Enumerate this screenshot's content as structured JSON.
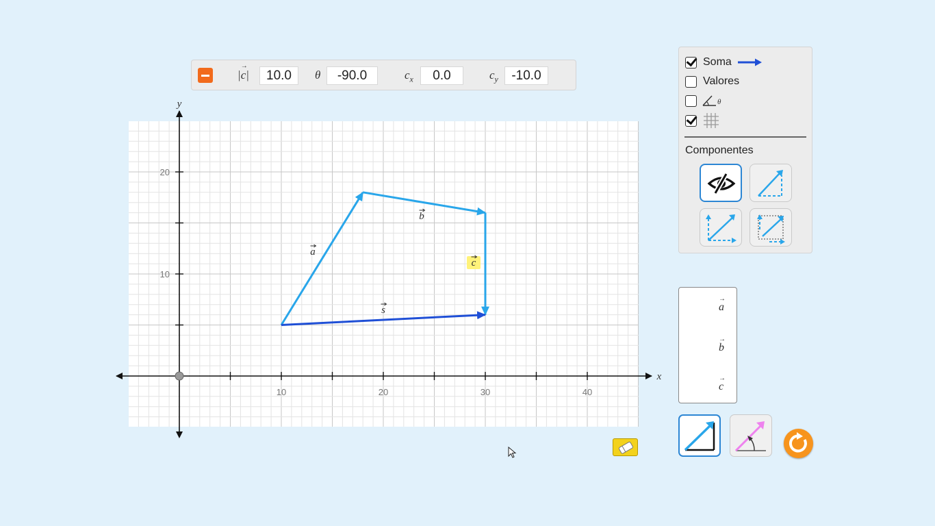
{
  "vector_info": {
    "magnitude_symbol": "c",
    "magnitude_value": "10.0",
    "angle_symbol": "θ",
    "angle_value": "-90.0",
    "cx_symbol": "c",
    "cx_sub": "x",
    "cx_value": "0.0",
    "cy_symbol": "c",
    "cy_sub": "y",
    "cy_value": "-10.0"
  },
  "graph": {
    "x_axis_label": "x",
    "y_axis_label": "y",
    "x_ticks": [
      "10",
      "20",
      "30",
      "40"
    ],
    "y_ticks": [
      "10",
      "20"
    ],
    "vectors": [
      {
        "name": "a",
        "tail": [
          10,
          5
        ],
        "tip": [
          18,
          18
        ],
        "color": "#29a6ea"
      },
      {
        "name": "b",
        "tail": [
          18,
          18
        ],
        "tip": [
          30,
          16
        ],
        "color": "#29a6ea"
      },
      {
        "name": "c",
        "tail": [
          30,
          16
        ],
        "tip": [
          30,
          6
        ],
        "color": "#29a6ea",
        "selected": true
      },
      {
        "name": "s",
        "tail": [
          10,
          5
        ],
        "tip": [
          30,
          6
        ],
        "color": "#1f4fd6"
      }
    ]
  },
  "options": {
    "sum_label": "Soma",
    "sum_checked": true,
    "values_label": "Valores",
    "values_checked": false,
    "angle_checked": false,
    "angle_symbol": "θ",
    "grid_checked": true,
    "components_title": "Componentes",
    "component_modes": [
      "hidden",
      "parallelogram",
      "triangle-tail",
      "projection"
    ],
    "selected_component_mode": "hidden"
  },
  "legend": {
    "items": [
      "a",
      "b",
      "c"
    ]
  },
  "colors": {
    "background": "#e1f1fb",
    "vector": "#29a6ea",
    "sum": "#1f4fd6",
    "selected_label": "#fff27a",
    "remove": "#f26a1b",
    "reset": "#f7941d",
    "eraser": "#f3d21c",
    "polar_mode": "#ee82ee"
  },
  "icons": {
    "remove": "minus-icon",
    "eraser": "eraser-icon",
    "reset": "reset-icon",
    "cartesian_mode": "cartesian-vector-icon",
    "polar_mode": "polar-vector-icon"
  }
}
